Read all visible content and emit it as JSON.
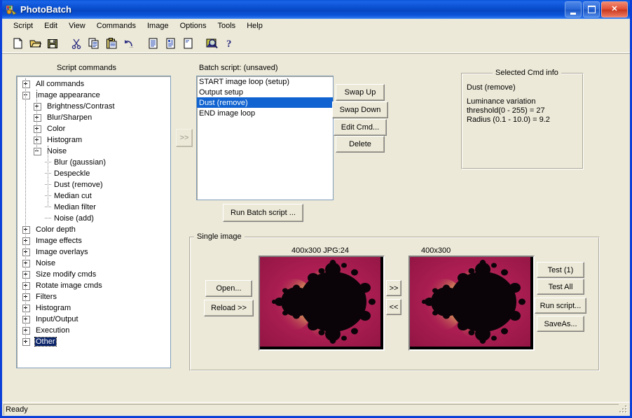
{
  "window": {
    "title": "PhotoBatch",
    "icon": "photobatch-app-icon",
    "minimize_label": "_",
    "maximize_label": "",
    "close_label": "✕"
  },
  "menubar": {
    "items": [
      "Script",
      "Edit",
      "View",
      "Commands",
      "Image",
      "Options",
      "Tools",
      "Help"
    ]
  },
  "toolbar": {
    "icons": [
      {
        "name": "new-file-icon"
      },
      {
        "name": "open-folder-icon"
      },
      {
        "name": "save-disk-icon"
      },
      {
        "name": "separator"
      },
      {
        "name": "cut-scissors-icon"
      },
      {
        "name": "copy-icon"
      },
      {
        "name": "paste-clipboard-icon"
      },
      {
        "name": "undo-arrow-icon"
      },
      {
        "name": "separator"
      },
      {
        "name": "document-lines-icon"
      },
      {
        "name": "document-list-icon"
      },
      {
        "name": "document-blank-icon"
      },
      {
        "name": "separator"
      },
      {
        "name": "zoom-preview-icon"
      },
      {
        "name": "help-question-icon"
      }
    ]
  },
  "script_commands": {
    "title": "Script commands",
    "tree": [
      {
        "label": "All commands",
        "indent": 0,
        "state": "plus"
      },
      {
        "label": "Image appearance",
        "indent": 0,
        "state": "minus"
      },
      {
        "label": "Brightness/Contrast",
        "indent": 1,
        "state": "plus"
      },
      {
        "label": "Blur/Sharpen",
        "indent": 1,
        "state": "plus"
      },
      {
        "label": "Color",
        "indent": 1,
        "state": "plus"
      },
      {
        "label": "Histogram",
        "indent": 1,
        "state": "plus"
      },
      {
        "label": "Noise",
        "indent": 1,
        "state": "minus"
      },
      {
        "label": "Blur (gaussian)",
        "indent": 2,
        "state": "leaf"
      },
      {
        "label": "Despeckle",
        "indent": 2,
        "state": "leaf"
      },
      {
        "label": "Dust (remove)",
        "indent": 2,
        "state": "leaf"
      },
      {
        "label": "Median cut",
        "indent": 2,
        "state": "leaf"
      },
      {
        "label": "Median filter",
        "indent": 2,
        "state": "leaf"
      },
      {
        "label": "Noise (add)",
        "indent": 2,
        "state": "leaf"
      },
      {
        "label": "Color depth",
        "indent": 0,
        "state": "plus"
      },
      {
        "label": "Image effects",
        "indent": 0,
        "state": "plus"
      },
      {
        "label": "Image overlays",
        "indent": 0,
        "state": "plus"
      },
      {
        "label": "Noise",
        "indent": 0,
        "state": "plus"
      },
      {
        "label": "Size modify cmds",
        "indent": 0,
        "state": "plus"
      },
      {
        "label": "Rotate image cmds",
        "indent": 0,
        "state": "plus"
      },
      {
        "label": "Filters",
        "indent": 0,
        "state": "plus"
      },
      {
        "label": "Histogram",
        "indent": 0,
        "state": "plus"
      },
      {
        "label": "Input/Output",
        "indent": 0,
        "state": "plus"
      },
      {
        "label": "Execution",
        "indent": 0,
        "state": "plus"
      },
      {
        "label": "Other",
        "indent": 0,
        "state": "plus",
        "selected": true
      }
    ],
    "add_button_label": ">>"
  },
  "batch_script": {
    "title": "Batch script: (unsaved)",
    "items": [
      {
        "label": "START image loop (setup)",
        "selected": false
      },
      {
        "label": "Output setup",
        "selected": false
      },
      {
        "label": "Dust (remove)",
        "selected": true
      },
      {
        "label": "END image loop",
        "selected": false
      }
    ],
    "buttons": {
      "swap_up": "Swap Up",
      "swap_down": "Swap Down",
      "edit_cmd": "Edit Cmd...",
      "delete": "Delete",
      "run_batch": "Run Batch script ..."
    }
  },
  "selected_cmd_info": {
    "title": "Selected Cmd info",
    "command": "Dust (remove)",
    "details": "Luminance variation\nthreshold(0 - 255) = 27\nRadius (0.1 - 10.0) = 9.2"
  },
  "single_image": {
    "title": "Single image",
    "source_caption": "400x300 JPG:24",
    "result_caption": "400x300",
    "buttons": {
      "open": "Open...",
      "reload": "Reload >>",
      "forward": ">>",
      "back": "<<",
      "test_one": "Test (1)",
      "test_all": "Test All",
      "run_script": "Run script...",
      "save_as": "SaveAs..."
    },
    "preview": {
      "type": "mandelbrot-fractal",
      "background_color": "#a81e52",
      "set_color": "#0a0408",
      "edge_color": "#f0d2a8"
    }
  },
  "statusbar": {
    "text": "Ready"
  }
}
